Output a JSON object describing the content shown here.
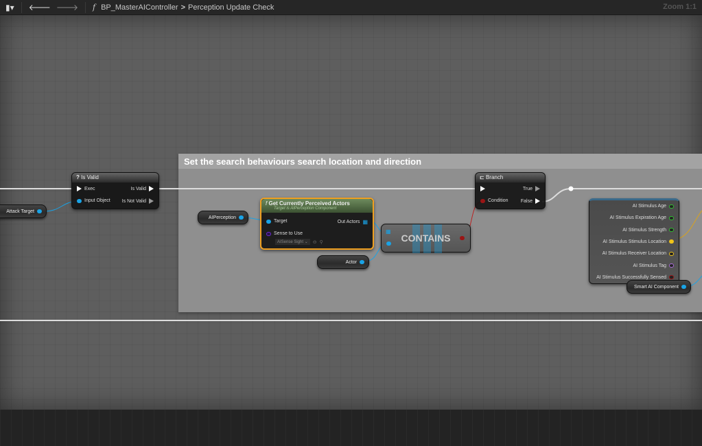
{
  "toolbar": {
    "breadcrumb_root": "BP_MasterAIController",
    "breadcrumb_separator": ">",
    "breadcrumb_current": "Perception Update Check",
    "zoom": "Zoom 1:1",
    "function_icon": "f"
  },
  "comment": {
    "title": "Set the search behaviours search location and direction"
  },
  "nodes": {
    "is_valid": {
      "title": "Is Valid",
      "icon": "?",
      "exec": "Exec",
      "input_object": "Input Object",
      "is_valid": "Is Valid",
      "is_not_valid": "Is Not Valid"
    },
    "attack_target": {
      "label": "Attack Target"
    },
    "ai_perception": {
      "label": "AIPerception"
    },
    "get_perceived": {
      "title": "Get Currently Perceived Actors",
      "subtitle": "Target is AIPerception Component",
      "target": "Target",
      "out_actors": "Out Actors",
      "sense_label": "Sense to Use",
      "sense_value": "AISense Sight"
    },
    "actor": {
      "label": "Actor"
    },
    "contains": {
      "label": "CONTAINS"
    },
    "branch": {
      "title": "Branch",
      "condition": "Condition",
      "true": "True",
      "false": "False"
    },
    "break_stimulus": {
      "pins": [
        "AI Stimulus Age",
        "AI Stimulus Expiration Age",
        "AI Stimulus Strength",
        "AI Stimulus Stimulus Location",
        "AI Stimulus Receiver Location",
        "AI Stimulus Tag",
        "AI Stimulus Successfully Sensed"
      ],
      "pin_colors": [
        "#2fbf2f",
        "#2fbf2f",
        "#2fbf2f",
        "#f0c419",
        "#f0c419",
        "#a96ad8",
        "#9a1515"
      ]
    },
    "smart_ai": {
      "label": "Smart AI Component"
    }
  }
}
